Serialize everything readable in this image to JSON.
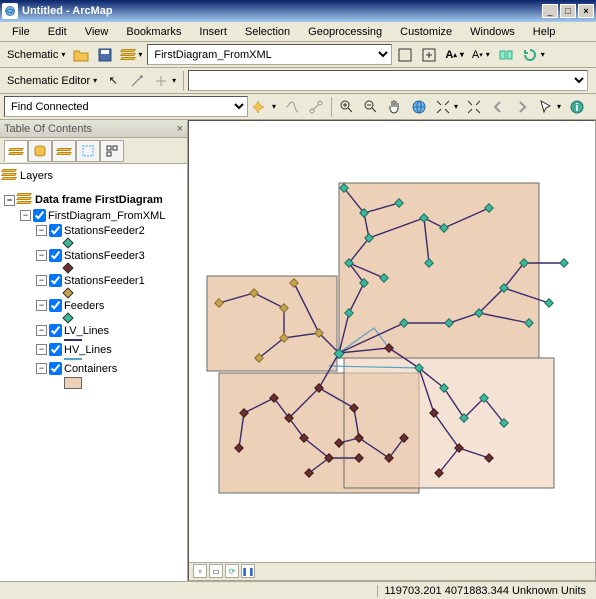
{
  "title": "Untitled - ArcMap",
  "menu": [
    "File",
    "Edit",
    "View",
    "Bookmarks",
    "Insert",
    "Selection",
    "Geoprocessing",
    "Customize",
    "Windows",
    "Help"
  ],
  "schematic_label": "Schematic",
  "schematic_editor_label": "Schematic Editor",
  "diagram_select": "FirstDiagram_FromXML",
  "operation_select": "Find Connected",
  "toc": {
    "title": "Table Of Contents",
    "layers_root": "Layers",
    "dataframe": "Data frame FirstDiagram",
    "diagram_layer": "FirstDiagram_FromXML",
    "sublayers": [
      {
        "name": "StationsFeeder2",
        "type": "point",
        "color": "#3db79b"
      },
      {
        "name": "StationsFeeder3",
        "type": "point",
        "color": "#6b2f2f"
      },
      {
        "name": "StationsFeeder1",
        "type": "point",
        "color": "#c6a44e"
      },
      {
        "name": "Feeders",
        "type": "point",
        "color": "#3db79b"
      },
      {
        "name": "LV_Lines",
        "type": "line",
        "color": "#3b2a6c"
      },
      {
        "name": "HV_Lines",
        "type": "line",
        "color": "#5aa0c8"
      },
      {
        "name": "Containers",
        "type": "rect",
        "color": "#ecd0b7"
      }
    ]
  },
  "status": {
    "coords": "119703.201 4071883.344 Unknown Units"
  }
}
